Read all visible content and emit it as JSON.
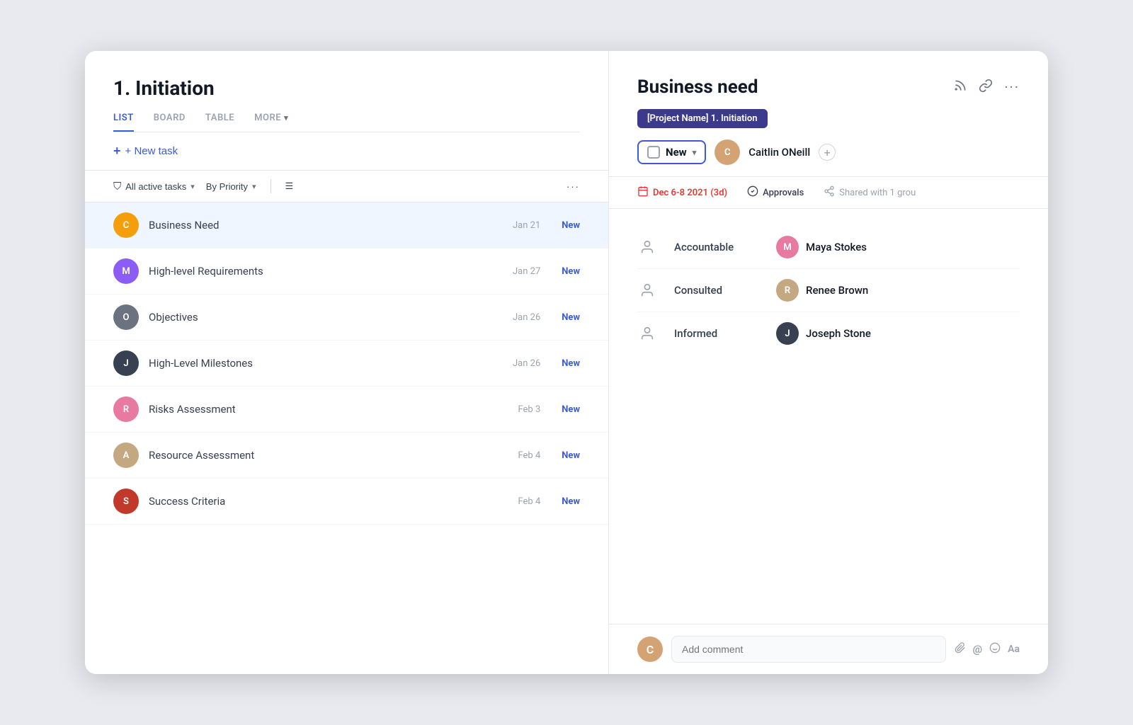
{
  "app": {
    "title": "1. Initiation"
  },
  "left": {
    "title": "1. Initiation",
    "tabs": [
      {
        "label": "LIST",
        "active": true
      },
      {
        "label": "BOARD",
        "active": false
      },
      {
        "label": "TABLE",
        "active": false
      },
      {
        "label": "MORE ▾",
        "active": false
      }
    ],
    "new_task_label": "+ New task",
    "filter": {
      "all_tasks": "All active tasks",
      "by_priority": "By Priority"
    },
    "tasks": [
      {
        "name": "Business Need",
        "date": "Jan 21",
        "status": "New",
        "active": true,
        "av": "av-1",
        "initials": "C"
      },
      {
        "name": "High-level Requirements",
        "date": "Jan 27",
        "status": "New",
        "active": false,
        "av": "av-2",
        "initials": "M"
      },
      {
        "name": "Objectives",
        "date": "Jan 26",
        "status": "New",
        "active": false,
        "av": "av-3",
        "initials": "O"
      },
      {
        "name": "High-Level Milestones",
        "date": "Jan 26",
        "status": "New",
        "active": false,
        "av": "av-4",
        "initials": "J"
      },
      {
        "name": "Risks Assessment",
        "date": "Feb 3",
        "status": "New",
        "active": false,
        "av": "av-5",
        "initials": "R"
      },
      {
        "name": "Resource Assessment",
        "date": "Feb 4",
        "status": "New",
        "active": false,
        "av": "av-6",
        "initials": "A"
      },
      {
        "name": "Success Criteria",
        "date": "Feb 4",
        "status": "New",
        "active": false,
        "av": "av-7",
        "initials": "S"
      }
    ]
  },
  "right": {
    "title": "Business need",
    "breadcrumb": "[Project Name] 1. Initiation",
    "status": "New",
    "assignee": "Caitlin ONeill",
    "meta": {
      "date": "Dec 6-8 2021 (3d)",
      "approvals": "Approvals",
      "shared": "Shared with 1 grou"
    },
    "raci": [
      {
        "role": "Accountable",
        "person": "Maya Stokes",
        "av": "av-5"
      },
      {
        "role": "Consulted",
        "person": "Renee Brown",
        "av": "av-6"
      },
      {
        "role": "Informed",
        "person": "Joseph Stone",
        "av": "av-4"
      }
    ],
    "comment_placeholder": "Add comment"
  },
  "icons": {
    "rss": "📡",
    "link": "🔗",
    "dots": "···",
    "filter": "⛉",
    "checklist": "☰",
    "calendar": "📅",
    "checkmark": "✓",
    "share": "⬡",
    "person": "👤",
    "clip": "📎",
    "at": "@",
    "emoji": "☺",
    "font": "Aa",
    "plus": "+"
  }
}
